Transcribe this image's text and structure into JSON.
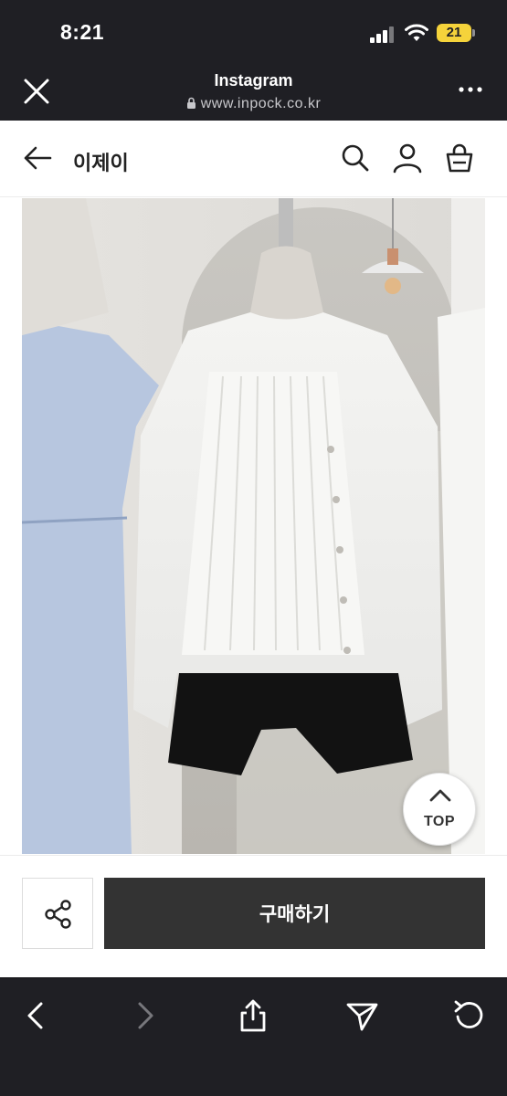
{
  "status_bar": {
    "time": "8:21",
    "battery_level": "21",
    "battery_color": "#f5d33b"
  },
  "browser_header": {
    "title": "Instagram",
    "url": "www.inpock.co.kr",
    "close_icon": "close-icon",
    "menu_icon": "more-icon"
  },
  "page_nav": {
    "shop_name": "이제이",
    "icons": [
      "back-arrow-icon",
      "search-icon",
      "user-icon",
      "shopping-bag-icon"
    ]
  },
  "product": {
    "image": "product-photo",
    "top_button_label": "TOP"
  },
  "action_bar": {
    "share_icon": "share-icon",
    "buy_label": "구매하기",
    "buy_color": "#333333"
  },
  "browser_toolbar": {
    "icons": [
      "back-chevron-icon",
      "forward-chevron-icon",
      "share-upload-icon",
      "send-icon",
      "reload-icon"
    ]
  }
}
